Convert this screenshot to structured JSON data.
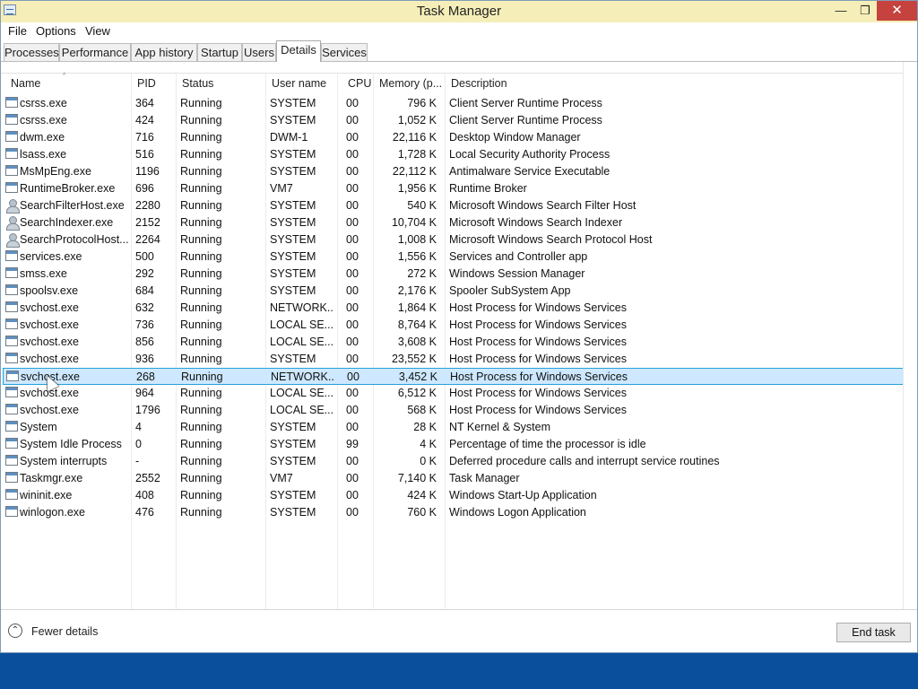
{
  "window": {
    "title": "Task Manager",
    "minimize": "—",
    "maximize": "❐",
    "close": "✕"
  },
  "menu": [
    "File",
    "Options",
    "View"
  ],
  "tabs": [
    "Processes",
    "Performance",
    "App history",
    "Startup",
    "Users",
    "Details",
    "Services"
  ],
  "active_tab": "Details",
  "columns": [
    "Name",
    "PID",
    "Status",
    "User name",
    "CPU",
    "Memory (p...",
    "Description"
  ],
  "sort_indicator": "^",
  "rows": [
    {
      "name": "csrss.exe",
      "pid": "364",
      "status": "Running",
      "user": "SYSTEM",
      "cpu": "00",
      "mem": "796 K",
      "desc": "Client Server Runtime Process",
      "icon": "app-window-icon"
    },
    {
      "name": "csrss.exe",
      "pid": "424",
      "status": "Running",
      "user": "SYSTEM",
      "cpu": "00",
      "mem": "1,052 K",
      "desc": "Client Server Runtime Process",
      "icon": "app-window-icon"
    },
    {
      "name": "dwm.exe",
      "pid": "716",
      "status": "Running",
      "user": "DWM-1",
      "cpu": "00",
      "mem": "22,116 K",
      "desc": "Desktop Window Manager",
      "icon": "app-window-icon"
    },
    {
      "name": "lsass.exe",
      "pid": "516",
      "status": "Running",
      "user": "SYSTEM",
      "cpu": "00",
      "mem": "1,728 K",
      "desc": "Local Security Authority Process",
      "icon": "app-window-icon"
    },
    {
      "name": "MsMpEng.exe",
      "pid": "1196",
      "status": "Running",
      "user": "SYSTEM",
      "cpu": "00",
      "mem": "22,112 K",
      "desc": "Antimalware Service Executable",
      "icon": "app-window-icon"
    },
    {
      "name": "RuntimeBroker.exe",
      "pid": "696",
      "status": "Running",
      "user": "VM7",
      "cpu": "00",
      "mem": "1,956 K",
      "desc": "Runtime Broker",
      "icon": "app-window-icon"
    },
    {
      "name": "SearchFilterHost.exe",
      "pid": "2280",
      "status": "Running",
      "user": "SYSTEM",
      "cpu": "00",
      "mem": "540 K",
      "desc": "Microsoft Windows Search Filter Host",
      "icon": "user-icon"
    },
    {
      "name": "SearchIndexer.exe",
      "pid": "2152",
      "status": "Running",
      "user": "SYSTEM",
      "cpu": "00",
      "mem": "10,704 K",
      "desc": "Microsoft Windows Search Indexer",
      "icon": "user-icon"
    },
    {
      "name": "SearchProtocolHost....",
      "pid": "2264",
      "status": "Running",
      "user": "SYSTEM",
      "cpu": "00",
      "mem": "1,008 K",
      "desc": "Microsoft Windows Search Protocol Host",
      "icon": "user-icon"
    },
    {
      "name": "services.exe",
      "pid": "500",
      "status": "Running",
      "user": "SYSTEM",
      "cpu": "00",
      "mem": "1,556 K",
      "desc": "Services and Controller app",
      "icon": "app-window-icon"
    },
    {
      "name": "smss.exe",
      "pid": "292",
      "status": "Running",
      "user": "SYSTEM",
      "cpu": "00",
      "mem": "272 K",
      "desc": "Windows Session Manager",
      "icon": "app-window-icon"
    },
    {
      "name": "spoolsv.exe",
      "pid": "684",
      "status": "Running",
      "user": "SYSTEM",
      "cpu": "00",
      "mem": "2,176 K",
      "desc": "Spooler SubSystem App",
      "icon": "printer-icon"
    },
    {
      "name": "svchost.exe",
      "pid": "632",
      "status": "Running",
      "user": "NETWORK...",
      "cpu": "00",
      "mem": "1,864 K",
      "desc": "Host Process for Windows Services",
      "icon": "app-window-icon"
    },
    {
      "name": "svchost.exe",
      "pid": "736",
      "status": "Running",
      "user": "LOCAL SE...",
      "cpu": "00",
      "mem": "8,764 K",
      "desc": "Host Process for Windows Services",
      "icon": "app-window-icon"
    },
    {
      "name": "svchost.exe",
      "pid": "856",
      "status": "Running",
      "user": "LOCAL SE...",
      "cpu": "00",
      "mem": "3,608 K",
      "desc": "Host Process for Windows Services",
      "icon": "app-window-icon"
    },
    {
      "name": "svchost.exe",
      "pid": "936",
      "status": "Running",
      "user": "SYSTEM",
      "cpu": "00",
      "mem": "23,552 K",
      "desc": "Host Process for Windows Services",
      "icon": "app-window-icon"
    },
    {
      "name": "svchost.exe",
      "pid": "268",
      "status": "Running",
      "user": "NETWORK...",
      "cpu": "00",
      "mem": "3,452 K",
      "desc": "Host Process for Windows Services",
      "icon": "app-window-icon",
      "selected": true
    },
    {
      "name": "svchost.exe",
      "pid": "964",
      "status": "Running",
      "user": "LOCAL SE...",
      "cpu": "00",
      "mem": "6,512 K",
      "desc": "Host Process for Windows Services",
      "icon": "app-window-icon"
    },
    {
      "name": "svchost.exe",
      "pid": "1796",
      "status": "Running",
      "user": "LOCAL SE...",
      "cpu": "00",
      "mem": "568 K",
      "desc": "Host Process for Windows Services",
      "icon": "app-window-icon"
    },
    {
      "name": "System",
      "pid": "4",
      "status": "Running",
      "user": "SYSTEM",
      "cpu": "00",
      "mem": "28 K",
      "desc": "NT Kernel & System",
      "icon": "app-window-icon"
    },
    {
      "name": "System Idle Process",
      "pid": "0",
      "status": "Running",
      "user": "SYSTEM",
      "cpu": "99",
      "mem": "4 K",
      "desc": "Percentage of time the processor is idle",
      "icon": "app-window-icon"
    },
    {
      "name": "System interrupts",
      "pid": "-",
      "status": "Running",
      "user": "SYSTEM",
      "cpu": "00",
      "mem": "0 K",
      "desc": "Deferred procedure calls and interrupt service routines",
      "icon": "app-window-icon"
    },
    {
      "name": "Taskmgr.exe",
      "pid": "2552",
      "status": "Running",
      "user": "VM7",
      "cpu": "00",
      "mem": "7,140 K",
      "desc": "Task Manager",
      "icon": "task-manager-icon"
    },
    {
      "name": "wininit.exe",
      "pid": "408",
      "status": "Running",
      "user": "SYSTEM",
      "cpu": "00",
      "mem": "424 K",
      "desc": "Windows Start-Up Application",
      "icon": "app-window-icon"
    },
    {
      "name": "winlogon.exe",
      "pid": "476",
      "status": "Running",
      "user": "SYSTEM",
      "cpu": "00",
      "mem": "760 K",
      "desc": "Windows Logon Application",
      "icon": "app-window-icon"
    }
  ],
  "footer": {
    "fewer_details": "Fewer details",
    "fewer_icon": "⌃",
    "end_task": "End task"
  },
  "colors": {
    "title_bar": "#f6eeb8",
    "close_button": "#c6423e",
    "selection": "#cde8ff",
    "selection_border": "#26a0da",
    "desktop": "#0a4f9c"
  }
}
